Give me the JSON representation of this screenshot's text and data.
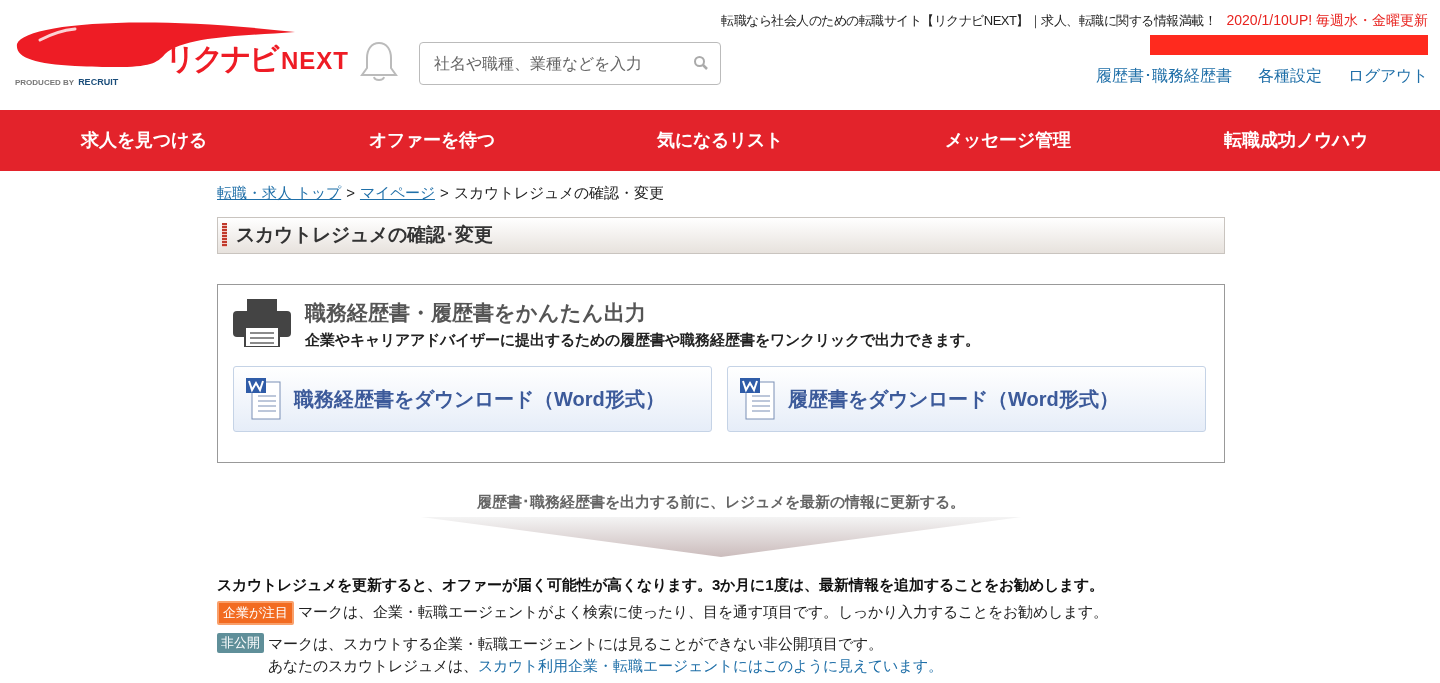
{
  "header": {
    "logo": {
      "wordmark": "リクナビ",
      "suffix": "NEXT",
      "produced_by": "PRODUCED BY",
      "company": "RECRUIT"
    },
    "tagline": "転職なら社会人のための転職サイト【リクナビNEXT】｜求人、転職に関する情報満載！",
    "update_note": "2020/1/10UP! 毎週水・金曜更新",
    "search": {
      "placeholder": "社名や職種、業種などを入力"
    },
    "links": [
      "履歴書･職務経歴書",
      "各種設定",
      "ログアウト"
    ]
  },
  "nav": [
    {
      "label": "求人を見つける"
    },
    {
      "label": "オファーを待つ"
    },
    {
      "label": "気になるリスト"
    },
    {
      "label": "メッセージ管理"
    },
    {
      "label": "転職成功ノウハウ"
    }
  ],
  "breadcrumb_separator": ">",
  "breadcrumb": [
    {
      "label": "転職・求人 トップ",
      "kind": "link"
    },
    {
      "label": "マイページ",
      "kind": "link"
    },
    {
      "label": "スカウトレジュメの確認・変更",
      "kind": "current"
    }
  ],
  "page_title": "スカウトレジュメの確認･変更",
  "print_panel": {
    "title": "職務経歴書・履歴書をかんたん出力",
    "description": "企業やキャリアアドバイザーに提出するための履歴書や職務経歴書をワンクリックで出力できます。",
    "buttons": [
      "職務経歴書をダウンロード（Word形式）",
      "履歴書をダウンロード（Word形式）"
    ]
  },
  "update_hint": "履歴書･職務経歴書を出力する前に、レジュメを最新の情報に更新する。",
  "intro": "スカウトレジュメを更新すると、オファーが届く可能性が高くなります。3か月に1度は、最新情報を追加することをお勧めします。",
  "marks": [
    {
      "badge": "企業が注目",
      "color": "#f26b21",
      "text": "マークは、企業・転職エージェントがよく検索に使ったり、目を通す項目です。しっかり入力することをお勧めします。"
    },
    {
      "badge": "非公開",
      "color": "#5f8f99",
      "text": "マークは、スカウトする企業・転職エージェントには見ることができない非公開項目です。",
      "note": "あなたのスカウトレジュメは、",
      "link": "スカウト利用企業・転職エージェントにはこのように見えています。"
    }
  ]
}
